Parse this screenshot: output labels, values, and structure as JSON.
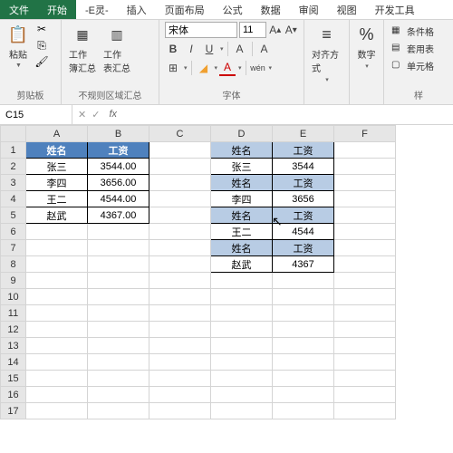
{
  "menu": {
    "file": "文件",
    "start": "开始",
    "eling": "-E灵-",
    "insert": "插入",
    "pagelayout": "页面布局",
    "formula": "公式",
    "data": "数据",
    "review": "审阅",
    "view": "视图",
    "dev": "开发工具"
  },
  "ribbon": {
    "clipboard": {
      "label": "剪贴板",
      "paste": "粘贴"
    },
    "irregular": {
      "label": "不规则区域汇总",
      "btn1": "工作\n簿汇总",
      "btn2": "工作\n表汇总"
    },
    "font": {
      "label": "字体",
      "name": "宋体",
      "size": "11",
      "wen": "wén"
    },
    "align": {
      "label": "对齐方式"
    },
    "number": {
      "label": "数字",
      "pct": "%"
    },
    "styles": {
      "label": "样",
      "cond": "条件格",
      "table": "套用表",
      "cell": "单元格"
    }
  },
  "namebox": {
    "ref": "C15"
  },
  "cols": [
    "A",
    "B",
    "C",
    "D",
    "E",
    "F"
  ],
  "rows": [
    "1",
    "2",
    "3",
    "4",
    "5",
    "6",
    "7",
    "8",
    "9",
    "10",
    "11",
    "12",
    "13",
    "14",
    "15",
    "16",
    "17"
  ],
  "left_header": {
    "name": "姓名",
    "salary": "工资"
  },
  "left_data": [
    {
      "name": "张三",
      "salary": "3544.00"
    },
    {
      "name": "李四",
      "salary": "3656.00"
    },
    {
      "name": "王二",
      "salary": "4544.00"
    },
    {
      "name": "赵武",
      "salary": "4367.00"
    }
  ],
  "right": [
    {
      "c1": "姓名",
      "c2": "工资",
      "h": true
    },
    {
      "c1": "张三",
      "c2": "3544"
    },
    {
      "c1": "姓名",
      "c2": "工资",
      "h": true
    },
    {
      "c1": "李四",
      "c2": "3656"
    },
    {
      "c1": "姓名",
      "c2": "工资",
      "h": true
    },
    {
      "c1": "王二",
      "c2": "4544"
    },
    {
      "c1": "姓名",
      "c2": "工资",
      "h": true
    },
    {
      "c1": "赵武",
      "c2": "4367"
    }
  ]
}
